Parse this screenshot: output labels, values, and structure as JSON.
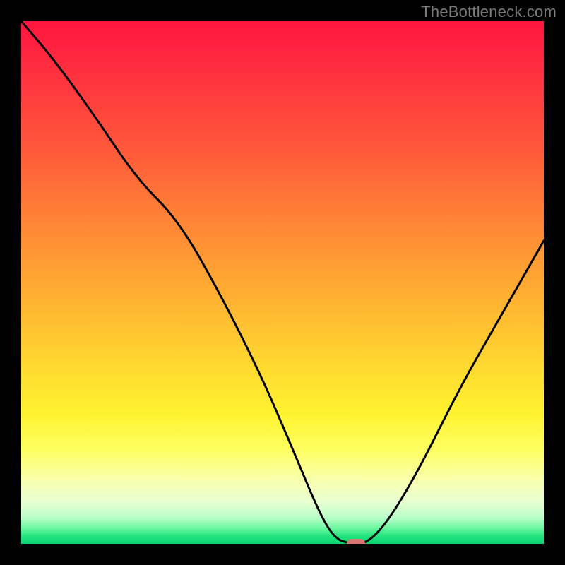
{
  "watermark": "TheBottleneck.com",
  "chart_data": {
    "type": "line",
    "title": "",
    "xlabel": "",
    "ylabel": "",
    "xlim": [
      0,
      100
    ],
    "ylim": [
      0,
      100
    ],
    "grid": false,
    "legend": false,
    "background_gradient": {
      "direction": "vertical_top_to_bottom",
      "stops": [
        {
          "pos": 0,
          "color": "#ff153e"
        },
        {
          "pos": 0.25,
          "color": "#ff5a3a"
        },
        {
          "pos": 0.54,
          "color": "#ffb431"
        },
        {
          "pos": 0.75,
          "color": "#fff22f"
        },
        {
          "pos": 0.92,
          "color": "#e8ffd0"
        },
        {
          "pos": 1.0,
          "color": "#0ad472"
        }
      ]
    },
    "series": [
      {
        "name": "bottleneck-curve",
        "color": "#000000",
        "x": [
          0,
          6,
          14,
          22,
          30,
          38,
          46,
          52,
          57,
          60,
          63,
          66,
          70,
          76,
          84,
          92,
          100
        ],
        "y": [
          100,
          93,
          82,
          70,
          62,
          48,
          32,
          18,
          6,
          1,
          0,
          0,
          4,
          14,
          30,
          44,
          58
        ]
      }
    ],
    "marker": {
      "name": "optimal-point",
      "x": 64,
      "y": 0,
      "color": "#d87772"
    }
  }
}
